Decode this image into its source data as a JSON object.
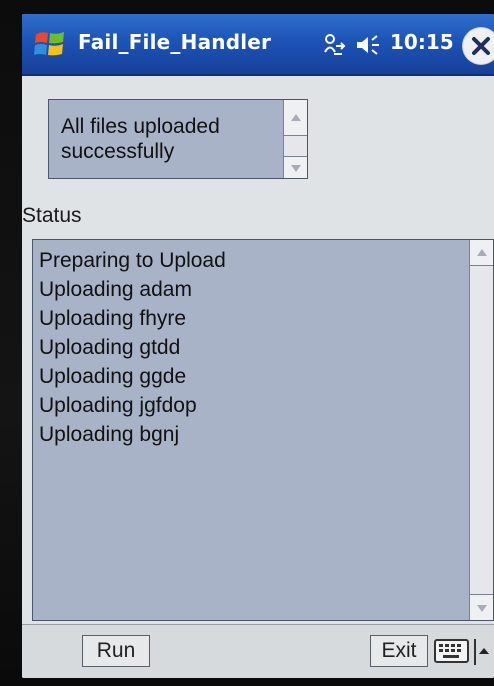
{
  "titlebar": {
    "app_title": "Fail_File_Handler",
    "time": "10:15",
    "start_icon": "windows-flag-icon",
    "connectivity_icon": "connectivity-icon",
    "volume_icon": "volume-icon",
    "close_icon": "close-icon"
  },
  "message": {
    "text": "All files uploaded successfully"
  },
  "status": {
    "label": "Status",
    "items": [
      "Preparing to Upload",
      "Uploading adam",
      "Uploading fhyre",
      "Uploading gtdd",
      "Uploading ggde",
      "Uploading jgfdop",
      "Uploading bgnj"
    ]
  },
  "softkeys": {
    "run_label": "Run",
    "exit_label": "Exit",
    "keyboard_icon": "keyboard-icon",
    "sip_menu_icon": "chevron-up-icon"
  },
  "colors": {
    "titlebar": "#1c53b6",
    "listbox": "#a9b3c8",
    "screen": "#dfe3e6"
  }
}
